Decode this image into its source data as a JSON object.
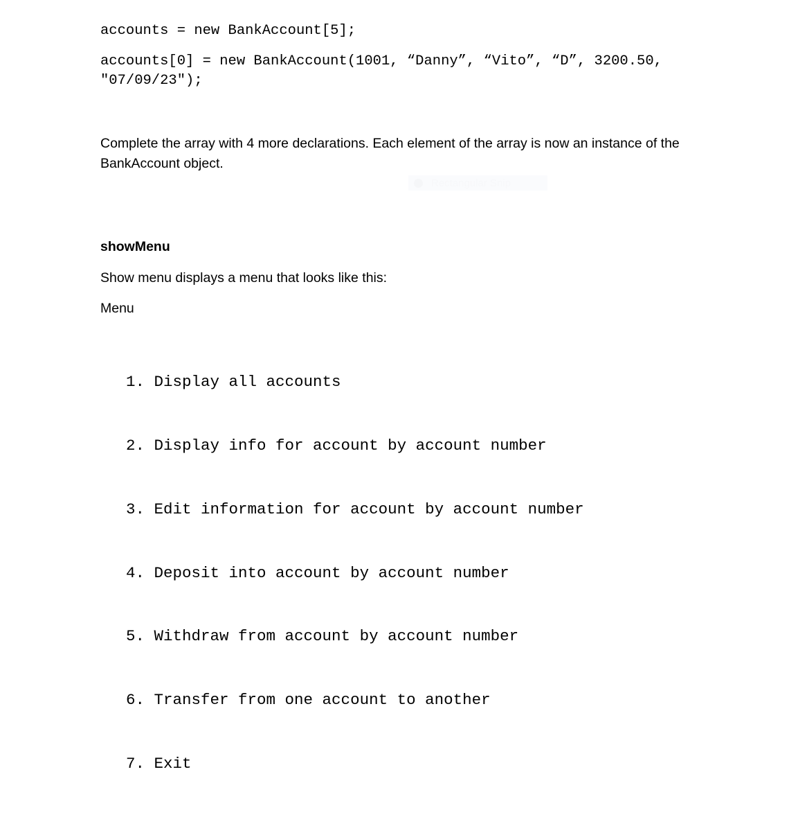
{
  "document": {
    "code_lines": [
      "accounts = new BankAccount[5];",
      "accounts[0] = new BankAccount(1001, “Danny”, “Vito”, “D”, 3200.50, \"07/09/23\");"
    ],
    "paragraph_complete": "Complete the array with 4 more declarations.  Each element of the array is now an instance of the BankAccount object.",
    "heading_show_menu": "showMenu",
    "line_show_menu_desc": "Show menu displays a menu that looks like this:",
    "line_menu_label": "Menu",
    "menu_items": [
      {
        "number": "1.",
        "text": " Display all accounts"
      },
      {
        "number": "2.",
        "text": " Display info for account by account number"
      },
      {
        "number": "3.",
        "text": " Edit information for account by account number"
      },
      {
        "number": "4.",
        "text": " Deposit into account by account number"
      },
      {
        "number": "5.",
        "text": " Withdraw from account by account number"
      },
      {
        "number": "6.",
        "text": " Transfer from one account to another"
      },
      {
        "number": "7.",
        "text": " Exit"
      }
    ]
  },
  "overlay": {
    "snip_tool_label": "Rectangular Snip",
    "snip_tool_icon": "circle-icon"
  },
  "colors": {
    "page_background": "#ffffff",
    "text": "#000000",
    "overlay_band": "#fafbfd",
    "overlay_text": "#f7f8fa"
  }
}
